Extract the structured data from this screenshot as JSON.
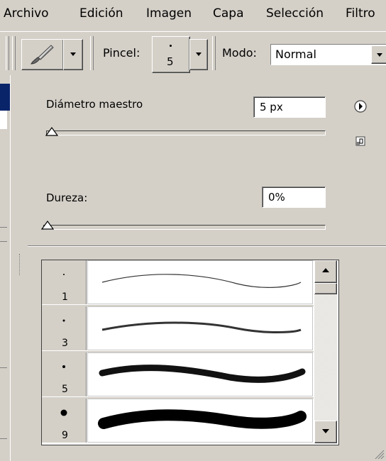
{
  "menu": {
    "items": [
      "Archivo",
      "Edición",
      "Imagen",
      "Capa",
      "Selección",
      "Filtro"
    ]
  },
  "options_bar": {
    "tool_icon": "paintbrush-icon",
    "brush_label": "Pincel:",
    "brush_preview_size": "5",
    "mode_label": "Modo:",
    "mode_value": "Normal"
  },
  "brush_panel": {
    "master_diameter_label": "Diámetro maestro",
    "master_diameter_value": "5 px",
    "master_diameter_slider": 0.02,
    "hardness_label": "Dureza:",
    "hardness_value": "0%",
    "hardness_slider": 0.0,
    "menu_button_icon": "circle-arrow-right-icon",
    "new_preset_icon": "new-preset-icon",
    "presets": [
      {
        "size": "1"
      },
      {
        "size": "3"
      },
      {
        "size": "5"
      },
      {
        "size": "9"
      }
    ]
  }
}
